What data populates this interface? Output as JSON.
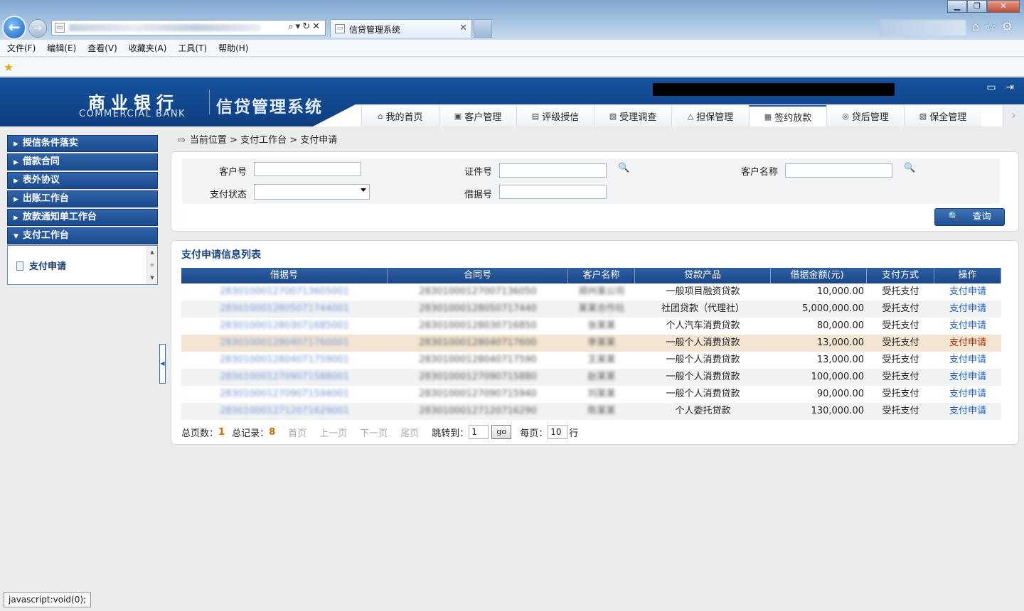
{
  "browser": {
    "tab_title": "信贷管理系统",
    "menu": [
      "文件(F)",
      "编辑(E)",
      "查看(V)",
      "收藏夹(A)",
      "工具(T)",
      "帮助(H)"
    ],
    "status_text": "javascript:void(0);"
  },
  "header": {
    "bank_name_cn": "商业银行",
    "bank_name_en": "COMMERCIAL BANK",
    "system_title": "信贷管理系统",
    "nav": [
      {
        "label": "我的首页",
        "icon": "home-icon",
        "glyph": "⌂"
      },
      {
        "label": "客户管理",
        "icon": "customer-icon",
        "glyph": "▣"
      },
      {
        "label": "评级授信",
        "icon": "rating-icon",
        "glyph": "▤"
      },
      {
        "label": "受理调查",
        "icon": "survey-icon",
        "glyph": "▧"
      },
      {
        "label": "担保管理",
        "icon": "guarantee-icon",
        "glyph": "△"
      },
      {
        "label": "签约放款",
        "icon": "contract-icon",
        "glyph": "▦"
      },
      {
        "label": "贷后管理",
        "icon": "post-loan-icon",
        "glyph": "◎"
      },
      {
        "label": "保全管理",
        "icon": "preservation-icon",
        "glyph": "▨"
      }
    ],
    "active_nav": "签约放款"
  },
  "sidebar": {
    "items": [
      "授信条件落实",
      "借款合同",
      "表外协议",
      "出账工作台",
      "放款通知单工作台",
      "支付工作台"
    ],
    "sub_items": [
      "支付申请"
    ]
  },
  "breadcrumb": "当前位置 > 支付工作台 > 支付申请",
  "search": {
    "customer_no_label": "客户号",
    "id_no_label": "证件号",
    "customer_name_label": "客户名称",
    "pay_status_label": "支付状态",
    "receipt_no_label": "借据号",
    "customer_no_value": "",
    "id_no_value": "",
    "customer_name_value": "",
    "pay_status_value": "",
    "receipt_no_value": "",
    "query_button": "查询"
  },
  "list": {
    "title": "支付申请信息列表",
    "columns": [
      "借据号",
      "合同号",
      "客户名称",
      "贷款产品",
      "借据金额(元)",
      "支付方式",
      "操作"
    ],
    "rows": [
      {
        "receipt_no": "2830100012700713605001",
        "contract_no": "28301000127007136050",
        "customer": "郑州某公司",
        "product": "一般项目融资贷款",
        "amount": "10,000.00",
        "method": "受托支付",
        "action": "支付申请"
      },
      {
        "receipt_no": "2830100012805071744001",
        "contract_no": "28301000128050717440",
        "customer": "某某合作社",
        "product": "社团贷款（代理社）",
        "amount": "5,000,000.00",
        "method": "受托支付",
        "action": "支付申请"
      },
      {
        "receipt_no": "2830100012803071685001",
        "contract_no": "28301000128030716850",
        "customer": "张某某",
        "product": "个人汽车消费贷款",
        "amount": "80,000.00",
        "method": "受托支付",
        "action": "支付申请"
      },
      {
        "receipt_no": "2830100012804071760001",
        "contract_no": "28301000128040717600",
        "customer": "李某某",
        "product": "一般个人消费贷款",
        "amount": "13,000.00",
        "method": "受托支付",
        "action": "支付申请"
      },
      {
        "receipt_no": "2830100012804071759001",
        "contract_no": "28301000128040717590",
        "customer": "王某某",
        "product": "一般个人消费贷款",
        "amount": "13,000.00",
        "method": "受托支付",
        "action": "支付申请"
      },
      {
        "receipt_no": "2830100012709071588001",
        "contract_no": "28301000127090715880",
        "customer": "赵某某",
        "product": "一般个人消费贷款",
        "amount": "100,000.00",
        "method": "受托支付",
        "action": "支付申请"
      },
      {
        "receipt_no": "2830100012709071594001",
        "contract_no": "28301000127090715940",
        "customer": "刘某某",
        "product": "一般个人消费贷款",
        "amount": "90,000.00",
        "method": "受托支付",
        "action": "支付申请"
      },
      {
        "receipt_no": "2830100012712071629001",
        "contract_no": "28301000127120716290",
        "customer": "陈某某",
        "product": "个人委托贷款",
        "amount": "130,000.00",
        "method": "受托支付",
        "action": "支付申请"
      }
    ]
  },
  "pager": {
    "total_pages_label": "总页数：",
    "total_pages": "1",
    "total_records_label": "总记录：",
    "total_records": "8",
    "first": "首页",
    "prev": "上一页",
    "next": "下一页",
    "last": "尾页",
    "jump_label": "跳转到：",
    "jump_value": "1",
    "go": "go",
    "per_page_label": "每页：",
    "per_page_value": "10",
    "per_page_unit": "行"
  }
}
